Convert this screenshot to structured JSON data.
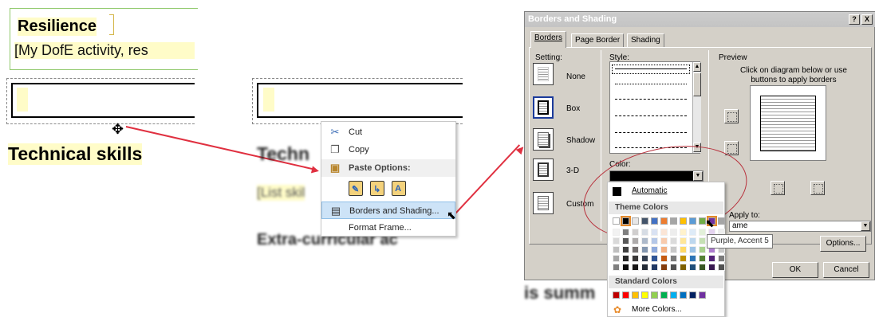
{
  "panel1": {
    "heading": "Resilience",
    "subtext": "[My DofE activity, res",
    "next_heading": "Technical skills"
  },
  "panel2": {
    "heading_blurred": "Techn",
    "list_blurred": "[List skil",
    "extra_blurred": "Extra-curricular ac",
    "context_menu": {
      "items": [
        {
          "label": "Cut",
          "icon": "scissors-icon"
        },
        {
          "label": "Copy",
          "icon": "copy-icon"
        },
        {
          "label": "Paste Options:",
          "icon": "paste-icon"
        },
        {
          "label": "Borders and Shading...",
          "icon": "borders-icon"
        },
        {
          "label": "Format Frame...",
          "icon": ""
        }
      ],
      "paste_icons": [
        "keep-formatting-icon",
        "merge-formatting-icon",
        "keep-text-only-icon"
      ]
    }
  },
  "dialog": {
    "title": "Borders and Shading",
    "title_buttons": [
      "?",
      "X"
    ],
    "tabs": [
      "Borders",
      "Page Border",
      "Shading"
    ],
    "setting_label": "Setting:",
    "settings": [
      "None",
      "Box",
      "Shadow",
      "3-D",
      "Custom"
    ],
    "style_label": "Style:",
    "color_label": "Color:",
    "preview_label": "Preview",
    "preview_hint": "Click on diagram below or use buttons to apply borders",
    "apply_label": "Apply to:",
    "apply_value": "ame",
    "options_button": "Options...",
    "ok_button": "OK",
    "cancel_button": "Cancel"
  },
  "color_picker": {
    "automatic_label": "Automatic",
    "theme_header": "Theme Colors",
    "standard_header": "Standard Colors",
    "more_colors": "More Colors...",
    "tooltip": "Purple, Accent 5",
    "theme_colors": [
      "#ffffff",
      "#000000",
      "#e7e6e6",
      "#44546a",
      "#4472c4",
      "#ed7d31",
      "#a5a5a5",
      "#ffc000",
      "#5b9bd5",
      "#70ad47",
      "#7030a0",
      "#a5a5a5"
    ],
    "standard_colors": [
      "#c00000",
      "#ff0000",
      "#ffc000",
      "#ffff00",
      "#92d050",
      "#00b050",
      "#00b0f0",
      "#0070c0",
      "#002060",
      "#7030a0"
    ],
    "shade_colors": [
      [
        "#f2f2f2",
        "#7f7f7f",
        "#d0cece",
        "#d6dce4",
        "#d9e2f3",
        "#fbe5d6",
        "#ededed",
        "#fff2cc",
        "#deebf7",
        "#e2f0d9",
        "#e4d3ef",
        "#ededed"
      ],
      [
        "#d9d9d9",
        "#595959",
        "#aeabab",
        "#adb9ca",
        "#b4c7e7",
        "#f8cbad",
        "#dbdbdb",
        "#ffe699",
        "#bdd7ee",
        "#c5e0b4",
        "#c9a7df",
        "#dbdbdb"
      ],
      [
        "#bfbfbf",
        "#404040",
        "#757171",
        "#8497b0",
        "#8faadc",
        "#f4b183",
        "#c9c9c9",
        "#ffd966",
        "#9dc3e6",
        "#a9d18e",
        "#ad7bcf",
        "#c9c9c9"
      ],
      [
        "#a6a6a6",
        "#262626",
        "#3a3838",
        "#333f50",
        "#2f5597",
        "#c55a11",
        "#7b7b7b",
        "#bf9000",
        "#2e75b6",
        "#548235",
        "#532379",
        "#7b7b7b"
      ],
      [
        "#7f7f7f",
        "#0d0d0d",
        "#171616",
        "#222a35",
        "#203864",
        "#843c0c",
        "#525252",
        "#7f6000",
        "#1f4e79",
        "#385723",
        "#381850",
        "#525252"
      ]
    ]
  },
  "panel3": {
    "bottom_text": "is summ"
  }
}
